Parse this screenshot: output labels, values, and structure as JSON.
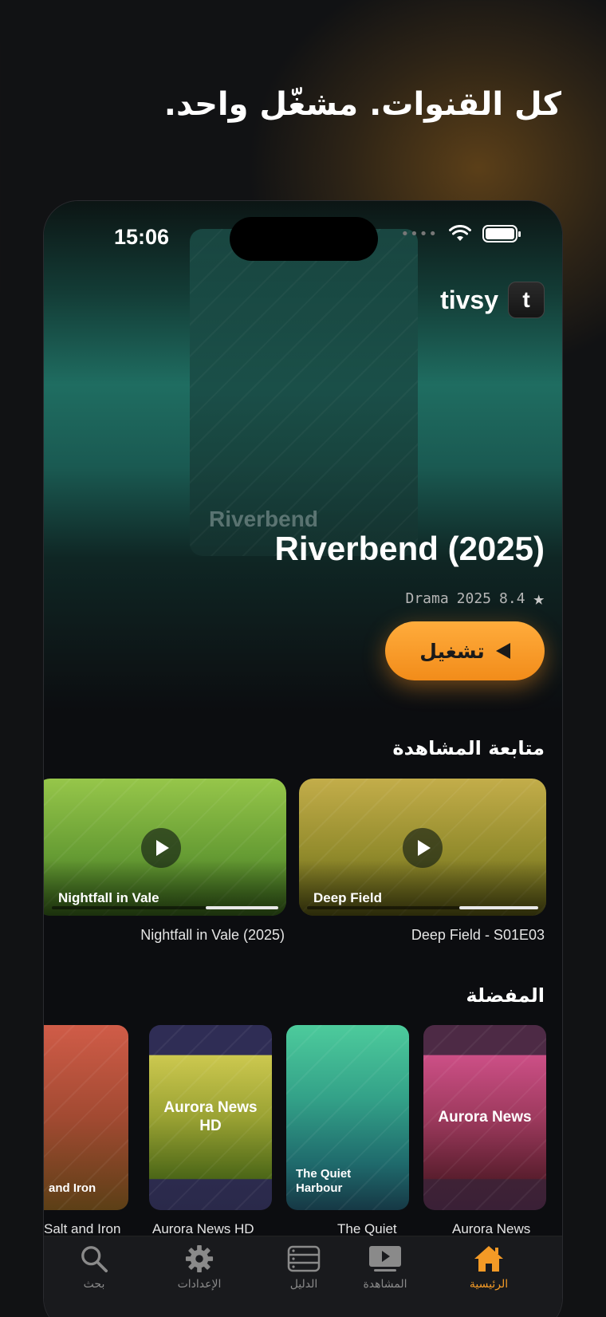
{
  "headline": "كل القنوات. مشغّل واحد.",
  "status": {
    "time": "15:06"
  },
  "brand": {
    "name": "tivsy",
    "logo_letter": "t"
  },
  "hero": {
    "card_label": "Riverbend",
    "title": "Riverbend (2025)",
    "meta_genre": "Drama",
    "meta_year": "2025",
    "meta_rating": "8.4",
    "play_label": "تشغيل"
  },
  "continue_watching": {
    "title": "متابعة المشاهدة",
    "items": [
      {
        "label": "Deep Field",
        "caption": "Deep Field - S01E03",
        "progress": 0.3
      },
      {
        "label": "Nightfall in Vale",
        "caption": "Nightfall in Vale (2025)",
        "progress": 0.3
      }
    ]
  },
  "favorites": {
    "title": "المفضلة",
    "items": [
      {
        "label": "Aurora News",
        "caption": "Aurora News"
      },
      {
        "label": "The Quiet Harbour",
        "caption": "The Quiet"
      },
      {
        "label": "Aurora News HD",
        "caption": "Aurora News HD"
      },
      {
        "label": "and Iron",
        "caption": "Salt and Iron"
      }
    ]
  },
  "tabs": [
    {
      "label": "الرئيسية",
      "icon": "home-icon",
      "active": true
    },
    {
      "label": "المشاهدة",
      "icon": "play-screen-icon",
      "active": false
    },
    {
      "label": "الدليل",
      "icon": "guide-icon",
      "active": false
    },
    {
      "label": "الإعدادات",
      "icon": "gear-icon",
      "active": false
    },
    {
      "label": "بحث",
      "icon": "search-icon",
      "active": false
    }
  ],
  "colors": {
    "accent": "#f39a26",
    "background": "#0c0d10"
  }
}
